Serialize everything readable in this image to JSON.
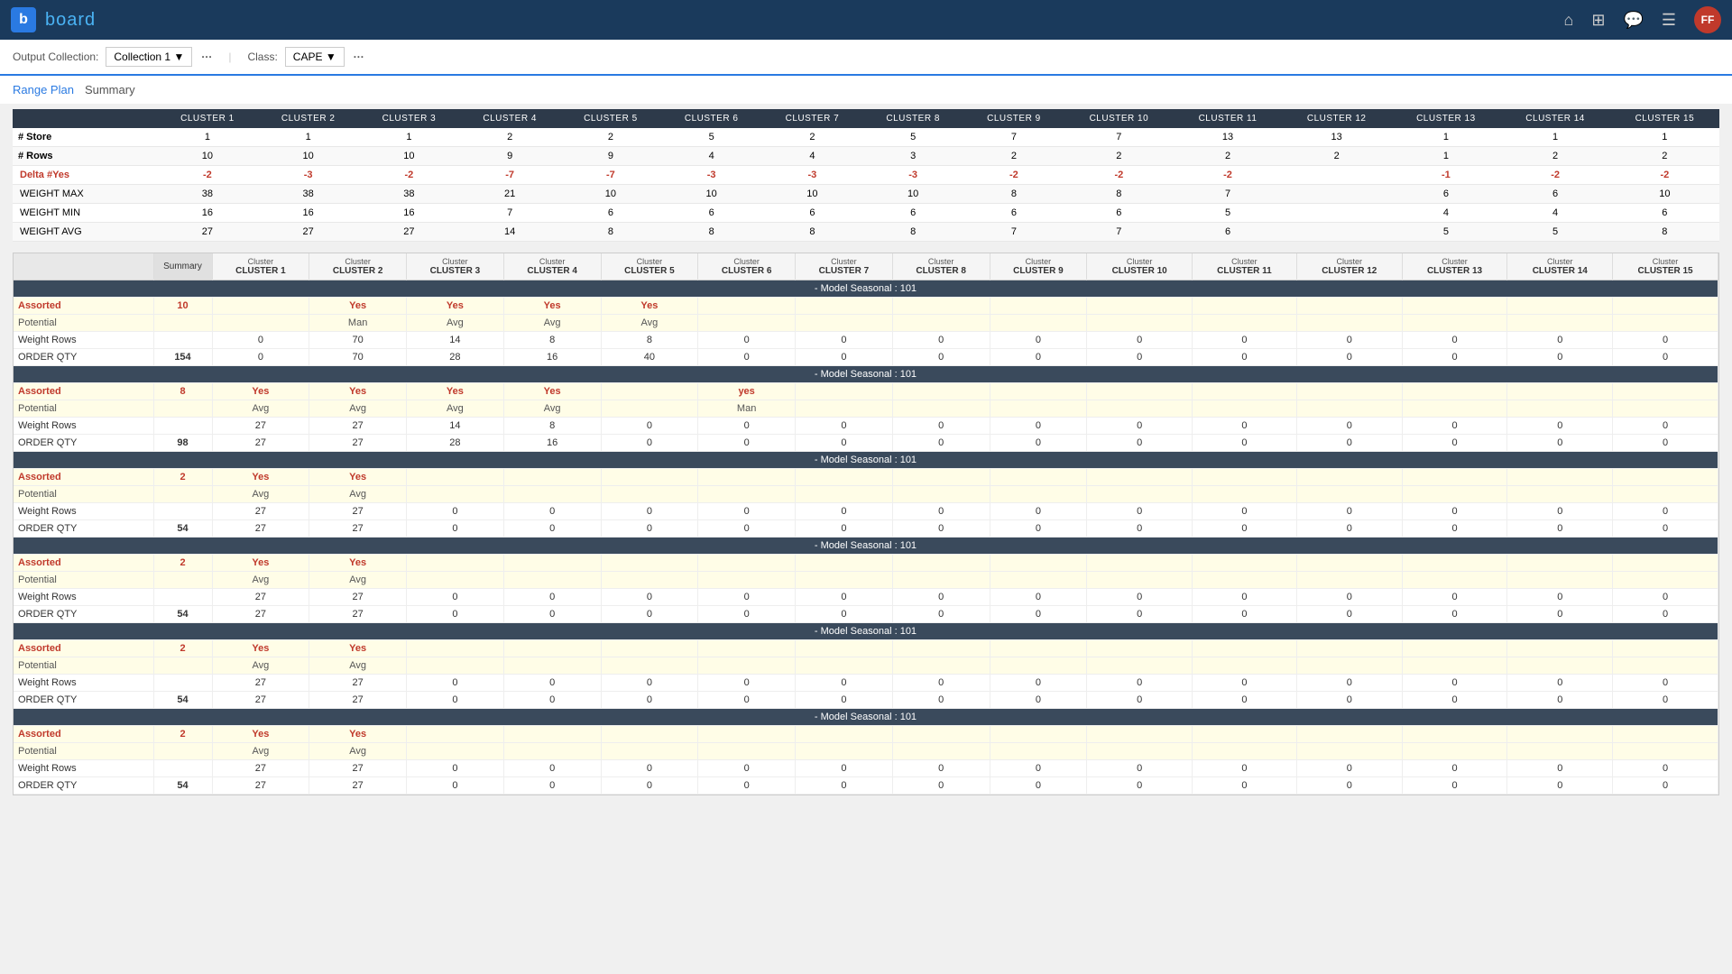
{
  "nav": {
    "logo_letter": "b",
    "logo_text": "board",
    "avatar_text": "FF"
  },
  "toolbar": {
    "output_label": "Output Collection:",
    "collection_value": "Collection 1",
    "class_label": "Class:",
    "class_value": "CAPE"
  },
  "breadcrumb": {
    "parent": "Range Plan",
    "current": "Summary"
  },
  "summary_table": {
    "headers": [
      "",
      "CLUSTER 1",
      "CLUSTER 2",
      "CLUSTER 3",
      "CLUSTER 4",
      "CLUSTER 5",
      "CLUSTER 6",
      "CLUSTER 7",
      "CLUSTER 8",
      "CLUSTER 9",
      "CLUSTER 10",
      "CLUSTER 11",
      "CLUSTER 12",
      "CLUSTER 13",
      "CLUSTER 14",
      "CLUSTER 15"
    ],
    "rows": [
      {
        "label": "# Store",
        "values": [
          "1",
          "1",
          "1",
          "2",
          "2",
          "5",
          "2",
          "5",
          "7",
          "7",
          "13",
          "13",
          "1",
          "1",
          "1"
        ]
      },
      {
        "label": "# Rows",
        "values": [
          "10",
          "10",
          "10",
          "9",
          "9",
          "4",
          "4",
          "3",
          "2",
          "2",
          "2",
          "2",
          "1",
          "2",
          "2"
        ]
      },
      {
        "label": "Delta #Yes",
        "values": [
          "-2",
          "-3",
          "-2",
          "-7",
          "-7",
          "-3",
          "-3",
          "-3",
          "-2",
          "-2",
          "-2",
          "",
          "-1",
          "-2",
          "-2"
        ],
        "delta": true
      },
      {
        "label": "WEIGHT MAX",
        "values": [
          "38",
          "38",
          "38",
          "21",
          "10",
          "10",
          "10",
          "10",
          "8",
          "8",
          "7",
          "",
          "6",
          "6",
          "10"
        ]
      },
      {
        "label": "WEIGHT MIN",
        "values": [
          "16",
          "16",
          "16",
          "7",
          "6",
          "6",
          "6",
          "6",
          "6",
          "6",
          "5",
          "",
          "4",
          "4",
          "6"
        ]
      },
      {
        "label": "WEIGHT AVG",
        "values": [
          "27",
          "27",
          "27",
          "14",
          "8",
          "8",
          "8",
          "8",
          "7",
          "7",
          "6",
          "",
          "5",
          "5",
          "8"
        ]
      }
    ]
  },
  "detail_table": {
    "cluster_headers": [
      "Cluster\nCLUSTER 1",
      "Cluster\nCLUSTER 2",
      "Cluster\nCLUSTER 3",
      "Cluster\nCLUSTER 4",
      "Cluster\nCLUSTER 5",
      "Cluster\nCLUSTER 6",
      "Cluster\nCLUSTER 7",
      "Cluster\nCLUSTER 8",
      "Cluster\nCLUSTER 9",
      "Cluster\nCLUSTER 10",
      "Cluster\nCLUSTER 11",
      "Cluster\nCLUSTER 12",
      "Cluster\nCLUSTER 13",
      "Cluster\nCLUSTER 14",
      "Cluster\nCLUSTER 15"
    ],
    "sections": [
      {
        "header": "- Model Seasonal : 101",
        "assorted_summary": "10",
        "assorted_values": [
          "",
          "Yes",
          "Yes",
          "Yes",
          "Yes",
          "",
          "",
          "",
          "",
          "",
          "",
          "",
          "",
          "",
          ""
        ],
        "potential_values": [
          "",
          "Man",
          "Avg",
          "Avg",
          "Avg",
          "",
          "",
          "",
          "",
          "",
          "",
          "",
          "",
          "",
          ""
        ],
        "weight_summary": "",
        "weight_values": [
          "0",
          "70",
          "14",
          "8",
          "8",
          "0",
          "0",
          "0",
          "0",
          "0",
          "0",
          "0",
          "0",
          "0",
          "0"
        ],
        "order_summary": "154",
        "order_values": [
          "0",
          "70",
          "28",
          "16",
          "40",
          "0",
          "0",
          "0",
          "0",
          "0",
          "0",
          "0",
          "0",
          "0",
          "0"
        ]
      },
      {
        "header": "- Model Seasonal : 101",
        "assorted_summary": "8",
        "assorted_values": [
          "Yes",
          "Yes",
          "Yes",
          "Yes",
          "",
          "yes",
          "",
          "",
          "",
          "",
          "",
          "",
          "",
          "",
          ""
        ],
        "potential_values": [
          "Avg",
          "Avg",
          "Avg",
          "Avg",
          "",
          "Man",
          "",
          "",
          "",
          "",
          "",
          "",
          "",
          "",
          ""
        ],
        "weight_summary": "",
        "weight_values": [
          "27",
          "27",
          "14",
          "8",
          "0",
          "0",
          "0",
          "0",
          "0",
          "0",
          "0",
          "0",
          "0",
          "0",
          "0"
        ],
        "order_summary": "98",
        "order_values": [
          "27",
          "27",
          "28",
          "16",
          "0",
          "0",
          "0",
          "0",
          "0",
          "0",
          "0",
          "0",
          "0",
          "0",
          "0"
        ]
      },
      {
        "header": "- Model Seasonal : 101",
        "assorted_summary": "2",
        "assorted_values": [
          "Yes",
          "Yes",
          "",
          "",
          "",
          "",
          "",
          "",
          "",
          "",
          "",
          "",
          "",
          "",
          ""
        ],
        "potential_values": [
          "Avg",
          "Avg",
          "",
          "",
          "",
          "",
          "",
          "",
          "",
          "",
          "",
          "",
          "",
          "",
          ""
        ],
        "weight_summary": "",
        "weight_values": [
          "27",
          "27",
          "0",
          "0",
          "0",
          "0",
          "0",
          "0",
          "0",
          "0",
          "0",
          "0",
          "0",
          "0",
          "0"
        ],
        "order_summary": "54",
        "order_values": [
          "27",
          "27",
          "0",
          "0",
          "0",
          "0",
          "0",
          "0",
          "0",
          "0",
          "0",
          "0",
          "0",
          "0",
          "0"
        ]
      },
      {
        "header": "- Model Seasonal : 101",
        "assorted_summary": "2",
        "assorted_values": [
          "Yes",
          "Yes",
          "",
          "",
          "",
          "",
          "",
          "",
          "",
          "",
          "",
          "",
          "",
          "",
          ""
        ],
        "potential_values": [
          "Avg",
          "Avg",
          "",
          "",
          "",
          "",
          "",
          "",
          "",
          "",
          "",
          "",
          "",
          "",
          ""
        ],
        "weight_summary": "",
        "weight_values": [
          "27",
          "27",
          "0",
          "0",
          "0",
          "0",
          "0",
          "0",
          "0",
          "0",
          "0",
          "0",
          "0",
          "0",
          "0"
        ],
        "order_summary": "54",
        "order_values": [
          "27",
          "27",
          "0",
          "0",
          "0",
          "0",
          "0",
          "0",
          "0",
          "0",
          "0",
          "0",
          "0",
          "0",
          "0"
        ]
      },
      {
        "header": "- Model Seasonal : 101",
        "assorted_summary": "2",
        "assorted_values": [
          "Yes",
          "Yes",
          "",
          "",
          "",
          "",
          "",
          "",
          "",
          "",
          "",
          "",
          "",
          "",
          ""
        ],
        "potential_values": [
          "Avg",
          "Avg",
          "",
          "",
          "",
          "",
          "",
          "",
          "",
          "",
          "",
          "",
          "",
          "",
          ""
        ],
        "weight_summary": "",
        "weight_values": [
          "27",
          "27",
          "0",
          "0",
          "0",
          "0",
          "0",
          "0",
          "0",
          "0",
          "0",
          "0",
          "0",
          "0",
          "0"
        ],
        "order_summary": "54",
        "order_values": [
          "27",
          "27",
          "0",
          "0",
          "0",
          "0",
          "0",
          "0",
          "0",
          "0",
          "0",
          "0",
          "0",
          "0",
          "0"
        ]
      },
      {
        "header": "- Model Seasonal : 101",
        "assorted_summary": "2",
        "assorted_values": [
          "Yes",
          "Yes",
          "",
          "",
          "",
          "",
          "",
          "",
          "",
          "",
          "",
          "",
          "",
          "",
          ""
        ],
        "potential_values": [
          "Avg",
          "Avg",
          "",
          "",
          "",
          "",
          "",
          "",
          "",
          "",
          "",
          "",
          "",
          "",
          ""
        ],
        "weight_summary": "",
        "weight_values": [
          "27",
          "27",
          "0",
          "0",
          "0",
          "0",
          "0",
          "0",
          "0",
          "0",
          "0",
          "0",
          "0",
          "0",
          "0"
        ],
        "order_summary": "54",
        "order_values": [
          "27",
          "27",
          "0",
          "0",
          "0",
          "0",
          "0",
          "0",
          "0",
          "0",
          "0",
          "0",
          "0",
          "0",
          "0"
        ]
      }
    ],
    "row_labels": {
      "assorted": "Assorted",
      "potential": "Potential",
      "weight_rows": "Weight Rows",
      "order_qty": "ORDER QTY"
    }
  }
}
